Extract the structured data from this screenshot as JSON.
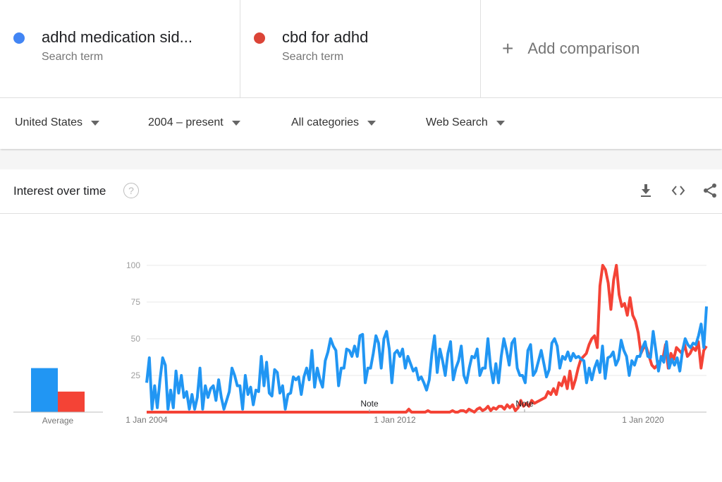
{
  "terms": [
    {
      "name": "adhd medication sid...",
      "subtitle": "Search term",
      "color": "#4285f4"
    },
    {
      "name": "cbd for adhd",
      "subtitle": "Search term",
      "color": "#db4437"
    }
  ],
  "add_comparison": {
    "icon": "plus-icon",
    "label": "Add comparison"
  },
  "filters": [
    {
      "label": "United States"
    },
    {
      "label": "2004 – present"
    },
    {
      "label": "All categories"
    },
    {
      "label": "Web Search"
    }
  ],
  "card": {
    "title": "Interest over time",
    "help_icon": "?",
    "actions": [
      "download-icon",
      "embed-icon",
      "share-icon"
    ]
  },
  "chart_data": {
    "type": "line",
    "title": "Interest over time",
    "ylim": [
      0,
      100
    ],
    "yticks": [
      25,
      50,
      75,
      100
    ],
    "xtick_labels": [
      "1 Jan 2004",
      "1 Jan 2012",
      "1 Jan 2020"
    ],
    "x_start": "2004-01",
    "x_step": "2 months",
    "grid": true,
    "notes": [
      {
        "label": "Note",
        "date": "2011-01"
      },
      {
        "label": "Note",
        "date": "2016-01"
      }
    ],
    "average": {
      "label": "Average",
      "values": [
        30,
        14
      ]
    },
    "series": [
      {
        "name": "adhd medication sid...",
        "color": "#2196f3",
        "values": [
          20,
          37,
          2,
          18,
          3,
          22,
          37,
          32,
          2,
          15,
          3,
          28,
          13,
          25,
          10,
          14,
          2,
          12,
          2,
          10,
          30,
          2,
          18,
          10,
          16,
          18,
          8,
          22,
          10,
          2,
          8,
          14,
          30,
          25,
          18,
          18,
          2,
          25,
          12,
          17,
          5,
          15,
          14,
          38,
          18,
          34,
          13,
          11,
          29,
          27,
          13,
          18,
          2,
          12,
          13,
          24,
          22,
          24,
          12,
          24,
          30,
          22,
          42,
          17,
          30,
          22,
          17,
          35,
          41,
          50,
          45,
          42,
          18,
          30,
          30,
          43,
          42,
          38,
          45,
          38,
          52,
          53,
          20,
          30,
          30,
          40,
          52,
          47,
          30,
          50,
          55,
          43,
          20,
          40,
          42,
          38,
          43,
          30,
          38,
          33,
          28,
          30,
          22,
          24,
          20,
          15,
          22,
          40,
          52,
          27,
          43,
          35,
          25,
          40,
          48,
          22,
          30,
          35,
          45,
          25,
          20,
          30,
          38,
          37,
          43,
          25,
          30,
          30,
          50,
          31,
          20,
          33,
          20,
          38,
          50,
          42,
          32,
          47,
          50,
          30,
          25,
          25,
          20,
          42,
          46,
          25,
          28,
          35,
          42,
          33,
          24,
          29,
          47,
          50,
          45,
          30,
          38,
          36,
          41,
          35,
          40,
          37,
          38,
          36,
          35,
          20,
          30,
          22,
          30,
          35,
          27,
          45,
          23,
          37,
          38,
          41,
          32,
          36,
          49,
          42,
          38,
          25,
          35,
          32,
          38,
          38,
          44,
          48,
          38,
          37,
          55,
          42,
          28,
          38,
          34,
          48,
          30,
          36,
          32,
          37,
          28,
          42,
          50,
          46,
          44,
          47,
          46,
          52,
          60,
          44,
          72
        ]
      },
      {
        "name": "cbd for adhd",
        "color": "#f44336",
        "values": [
          0,
          0,
          0,
          0,
          0,
          0,
          0,
          0,
          0,
          0,
          0,
          0,
          0,
          0,
          0,
          0,
          0,
          0,
          0,
          0,
          0,
          0,
          0,
          0,
          0,
          0,
          0,
          0,
          0,
          0,
          0,
          0,
          0,
          0,
          0,
          0,
          0,
          0,
          0,
          0,
          0,
          0,
          0,
          0,
          0,
          0,
          0,
          0,
          0,
          0,
          0,
          0,
          0,
          0,
          0,
          0,
          0,
          0,
          0,
          0,
          0,
          0,
          0,
          0,
          0,
          0,
          0,
          0,
          0,
          0,
          0,
          0,
          0,
          0,
          0,
          0,
          0,
          0,
          0,
          0,
          0,
          0,
          0,
          0,
          0,
          0,
          0,
          0,
          0,
          0,
          0,
          0,
          0,
          0,
          0,
          0,
          2,
          0,
          0,
          0,
          0,
          0,
          0,
          1,
          0,
          0,
          0,
          0,
          0,
          0,
          0,
          0,
          1,
          0,
          0,
          1,
          1,
          0,
          2,
          1,
          0,
          2,
          3,
          1,
          2,
          4,
          1,
          3,
          2,
          4,
          4,
          2,
          5,
          3,
          5,
          1,
          3,
          8,
          4,
          6,
          4,
          8,
          6,
          7,
          8,
          9,
          10,
          14,
          12,
          16,
          12,
          20,
          18,
          24,
          16,
          28,
          16,
          22,
          30,
          36,
          38,
          40,
          46,
          50,
          52,
          44,
          86,
          100,
          97,
          88,
          70,
          90,
          100,
          80,
          72,
          74,
          66,
          78,
          66,
          62,
          54,
          40,
          44,
          44,
          38,
          32,
          30,
          32,
          35,
          36,
          46,
          30,
          40,
          36,
          44,
          42,
          40,
          46,
          38,
          40,
          44,
          42,
          48,
          30,
          42,
          45
        ]
      }
    ]
  }
}
